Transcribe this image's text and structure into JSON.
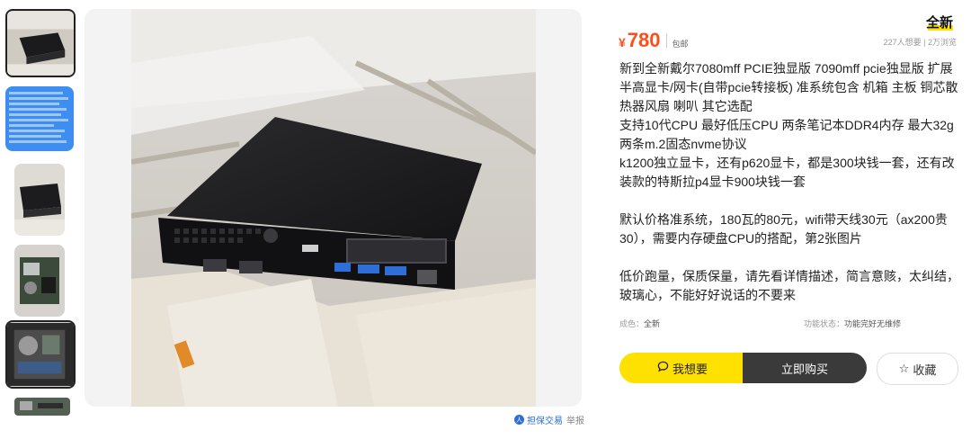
{
  "thumbnails": [
    {
      "name": "thumb-1",
      "label": "mini pc top view"
    },
    {
      "name": "thumb-2",
      "label": "text screenshot"
    },
    {
      "name": "thumb-3",
      "label": "mini pc angle"
    },
    {
      "name": "thumb-4",
      "label": "mini pc open board"
    },
    {
      "name": "thumb-5",
      "label": "mini pc internals"
    },
    {
      "name": "thumb-6",
      "label": "board close-up"
    }
  ],
  "condition_badge": "全新",
  "price": {
    "symbol": "¥",
    "value": "780",
    "shipping": "包邮"
  },
  "stats": "227人想要 | 2万浏览",
  "description": [
    "新到全新戴尔7080mff PCIE独显版 7090mff pcie独显版 扩展半高显卡/网卡(自带pcie转接板) 准系统包含 机箱 主板 铜芯散热器风扇 喇叭 其它选配",
    "支持10代CPU 最好低压CPU 两条笔记本DDR4内存 最大32g 两条m.2固态nvme协议",
    "k1200独立显卡，还有p620显卡，都是300块钱一套，还有改装款的特斯拉p4显卡900块钱一套",
    "",
    "默认价格准系统，180瓦的80元，wifi带天线30元（ax200贵30），需要内存硬盘CPU的搭配，第2张图片",
    "",
    "低价跑量，保质保量，请先看详情描述，简言意赅，太纠结，玻璃心，不能好好说话的不要来"
  ],
  "meta": {
    "condition_label": "成色：",
    "condition_value": "全新",
    "function_label": "功能状态：",
    "function_value": "功能完好无维修"
  },
  "buttons": {
    "want": "我想要",
    "buy": "立即购买",
    "favorite": "收藏"
  },
  "footer": {
    "guarantee": "担保交易",
    "report": "举报"
  },
  "colors": {
    "accent_yellow": "#ffe100",
    "price_orange": "#ff4d1a",
    "dark_button": "#3a3a3a",
    "link_blue": "#2b6fd6"
  }
}
